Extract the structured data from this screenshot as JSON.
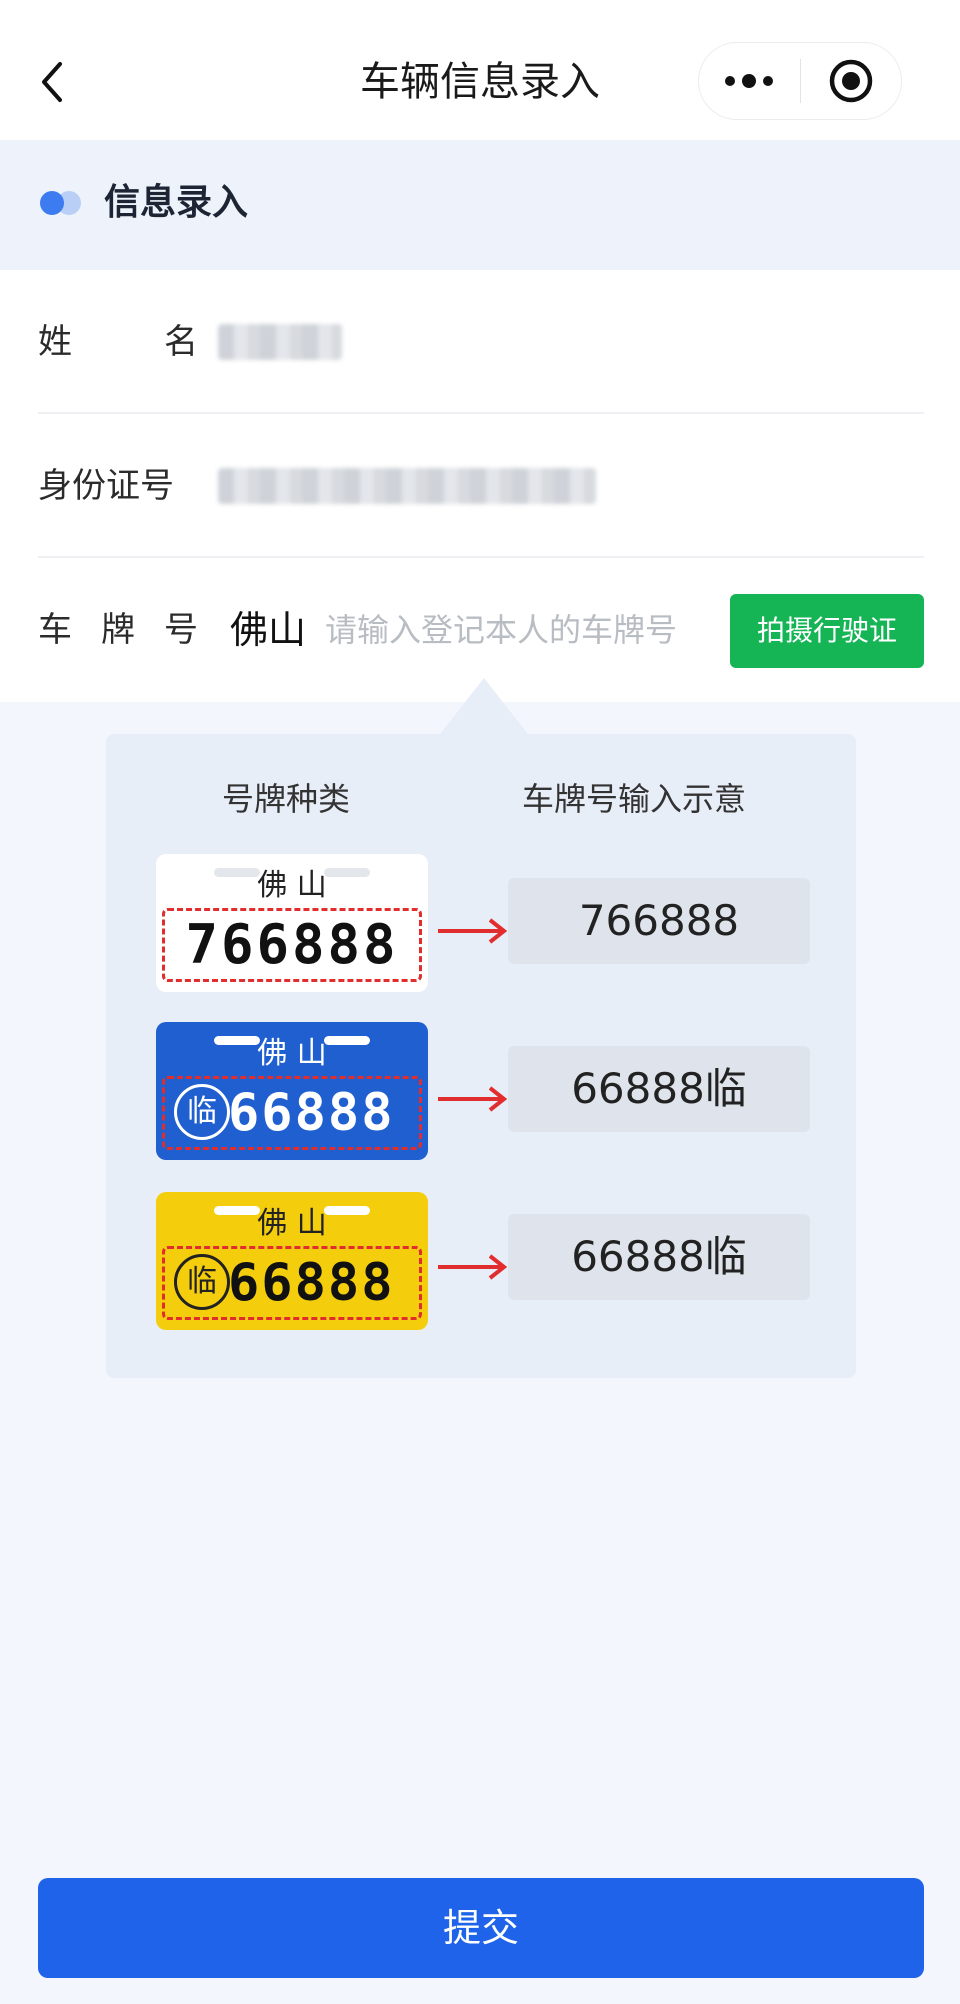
{
  "header": {
    "title": "车辆信息录入"
  },
  "section": {
    "title": "信息录入"
  },
  "form": {
    "name_label": [
      "姓",
      "名"
    ],
    "id_label": "身份证号",
    "plate_label": [
      "车",
      "牌",
      "号"
    ],
    "plate_prefix": "佛山",
    "plate_placeholder": "请输入登记本人的车牌号",
    "scan_button": "拍摄行驶证"
  },
  "guide": {
    "col_type": "号牌种类",
    "col_input": "车牌号输入示意",
    "plates": [
      {
        "city": "佛 山",
        "number": "766888",
        "result": "766888",
        "style": "white",
        "has_lin": false
      },
      {
        "city": "佛 山",
        "number": "66888",
        "result": "66888临",
        "style": "blue",
        "has_lin": true,
        "lin": "临"
      },
      {
        "city": "佛 山",
        "number": "66888",
        "result": "66888临",
        "style": "yellow",
        "has_lin": true,
        "lin": "临"
      }
    ]
  },
  "submit_label": "提交",
  "colors": {
    "primary": "#1e63ea",
    "scan_green": "#15b556",
    "dashed_red": "#e12d2d"
  }
}
